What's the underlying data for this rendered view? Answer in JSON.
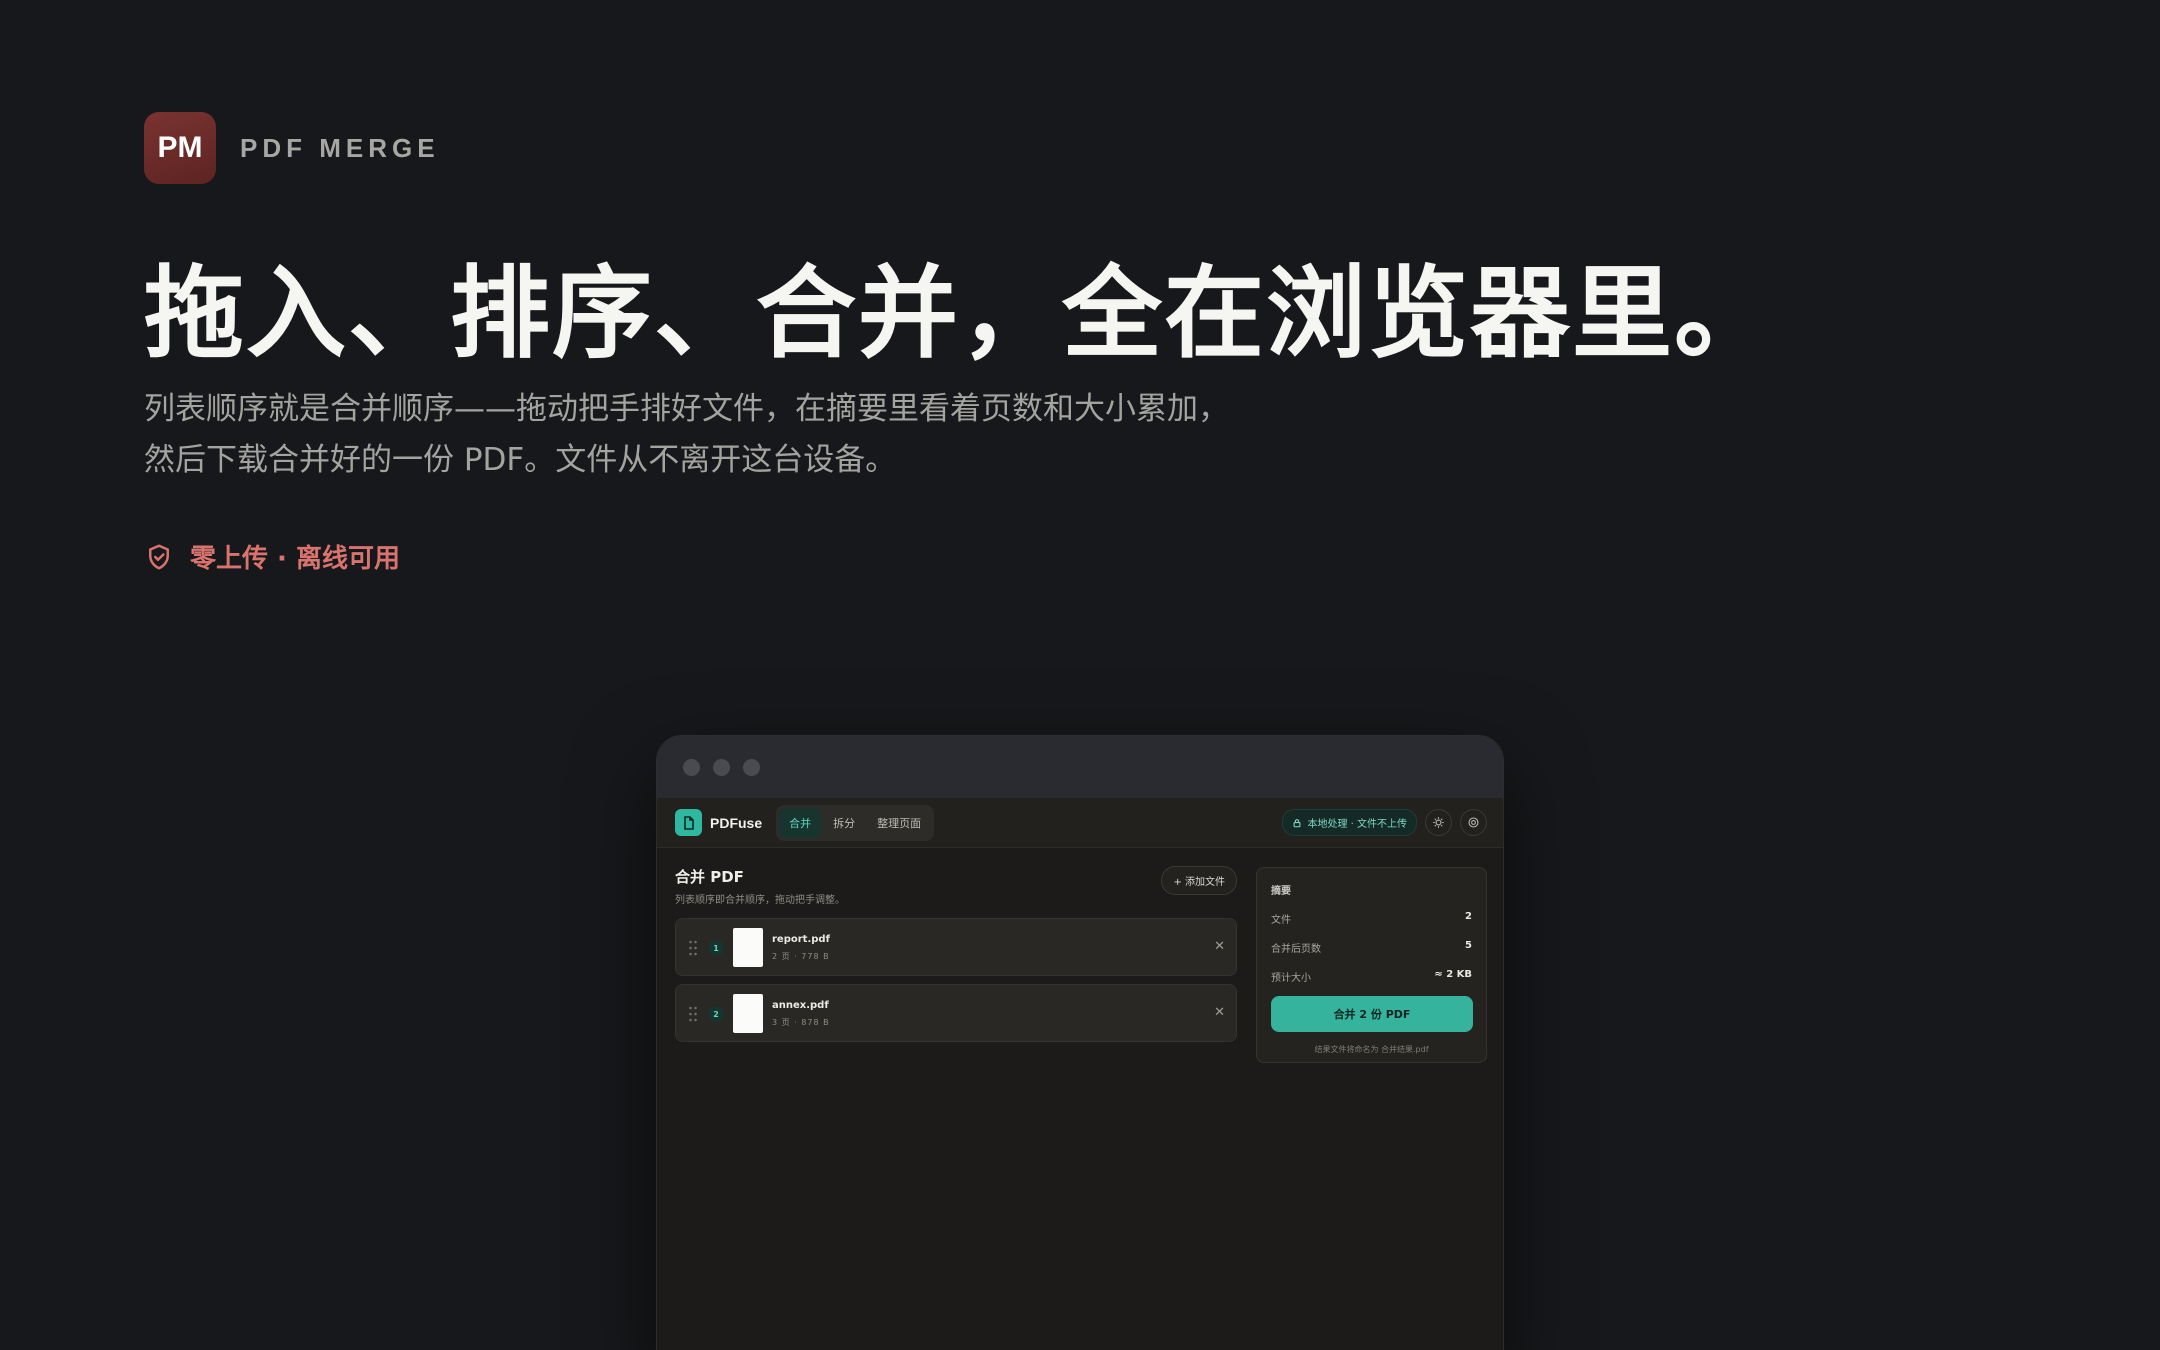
{
  "hero": {
    "app_icon_text": "PM",
    "brand_name": "PDF MERGE",
    "headline": "拖入、排序、合并，全在浏览器里。",
    "subtitle": "列表顺序就是合并顺序——拖动把手排好文件，在摘要里看着页数和大小累加，然后下载合并好的一份 PDF。文件从不离开这台设备。",
    "privacy_label": "零上传 · 离线可用"
  },
  "app": {
    "logo_text": "PDFuse",
    "tabs": [
      {
        "label": "合并",
        "active": true
      },
      {
        "label": "拆分",
        "active": false
      },
      {
        "label": "整理页面",
        "active": false
      }
    ],
    "local_badge": "本地处理 · 文件不上传",
    "main": {
      "title": "合并 PDF",
      "hint": "列表顺序即合并顺序，拖动把手调整。",
      "add_button": "+ 添加文件",
      "files": [
        {
          "index": "1",
          "name": "report.pdf",
          "meta": "2 页 · 778 B"
        },
        {
          "index": "2",
          "name": "annex.pdf",
          "meta": "3 页 · 878 B"
        }
      ]
    },
    "summary": {
      "title": "摘要",
      "rows": [
        {
          "label": "文件",
          "value": "2"
        },
        {
          "label": "合并后页数",
          "value": "5"
        },
        {
          "label": "预计大小",
          "value": "≈ 2 KB"
        }
      ],
      "merge_button": "合并 2 份 PDF",
      "note": "结果文件将命名为 合并结果.pdf"
    }
  },
  "colors": {
    "background": "#17181b",
    "app_icon": "#6e2d2a",
    "accent_teal": "#35b39d",
    "privacy_red": "#d9736d"
  },
  "icons": {
    "privacy": "shield-check-icon",
    "logo": "file-icon",
    "badge": "lock-icon",
    "theme": "sun-icon",
    "settings": "gear-icon",
    "grip": "drag-handle-icon",
    "remove": "close-icon"
  }
}
